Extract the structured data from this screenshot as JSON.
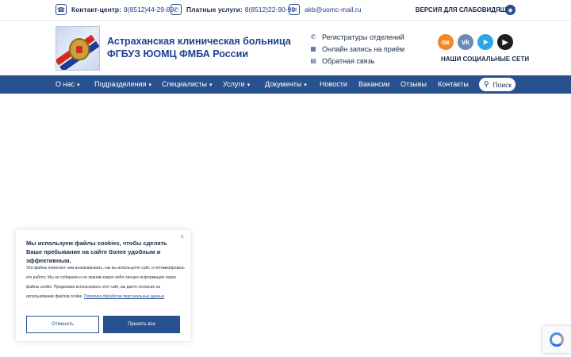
{
  "topbar": {
    "contact_center": {
      "label": "Контакт-центр:",
      "value": "8(8512)44-29-89",
      "icon": "headset-icon"
    },
    "paid_services": {
      "label": "Платные услуги:",
      "value": "8(8512)22-90-90",
      "icon": "phone-icon"
    },
    "email": {
      "value": "akb@uomc-mail.ru",
      "icon": "mail-icon"
    },
    "accessibility_label": "ВЕРСИЯ ДЛЯ СЛАБОВИДЯЩИХ",
    "accessibility_icon": "eye-icon"
  },
  "header": {
    "org_name_line1": "Астраханская клиническая больница",
    "org_name_line2": "ФГБУЗ ЮОМЦ ФМБА России",
    "quick_links": [
      {
        "label": "Регистратуры отделений",
        "icon": "phone-icon"
      },
      {
        "label": "Онлайн запись на приём",
        "icon": "calendar-icon"
      },
      {
        "label": "Обратная связь",
        "icon": "chat-icon"
      }
    ],
    "socials_label": "НАШИ СОЦИАЛЬНЫЕ СЕТИ",
    "socials": [
      {
        "name": "odnoklassniki",
        "glyph": "ок"
      },
      {
        "name": "vk",
        "glyph": "vk"
      },
      {
        "name": "telegram",
        "glyph": "➤"
      },
      {
        "name": "youtube",
        "glyph": "▶"
      }
    ]
  },
  "nav": {
    "items": [
      {
        "label": "О нас",
        "dropdown": true
      },
      {
        "label": "Подразделения",
        "dropdown": true
      },
      {
        "label": "Специалисты",
        "dropdown": true
      },
      {
        "label": "Услуги",
        "dropdown": true
      },
      {
        "label": "Документы",
        "dropdown": true
      },
      {
        "label": "Новости",
        "dropdown": false
      },
      {
        "label": "Вакансии",
        "dropdown": false
      },
      {
        "label": "Отзывы",
        "dropdown": false
      },
      {
        "label": "Контакты",
        "dropdown": false
      }
    ],
    "search_label": "Поиск"
  },
  "cookie": {
    "title": "Мы используем файлы cookies, чтобы сделать Ваше пребывание на сайте более удобным и эффективным.",
    "text": "Эти файлы помогают нам анализировать, как вы используете сайт, и оптимизировать его работу. Мы не собираем и не храним какую-либо личную информацию через файлы cookie. Продолжая использовать этот сайт, вы даете согласие на использование файлов cookie.",
    "link": "Политика обработки персональных данных",
    "cancel_label": "Отменить",
    "accept_label": "Принять все",
    "close_glyph": "×"
  },
  "colors": {
    "primary": "#27528f",
    "text_dark": "#1a2a4a",
    "link_blue": "#1d3f8f"
  }
}
